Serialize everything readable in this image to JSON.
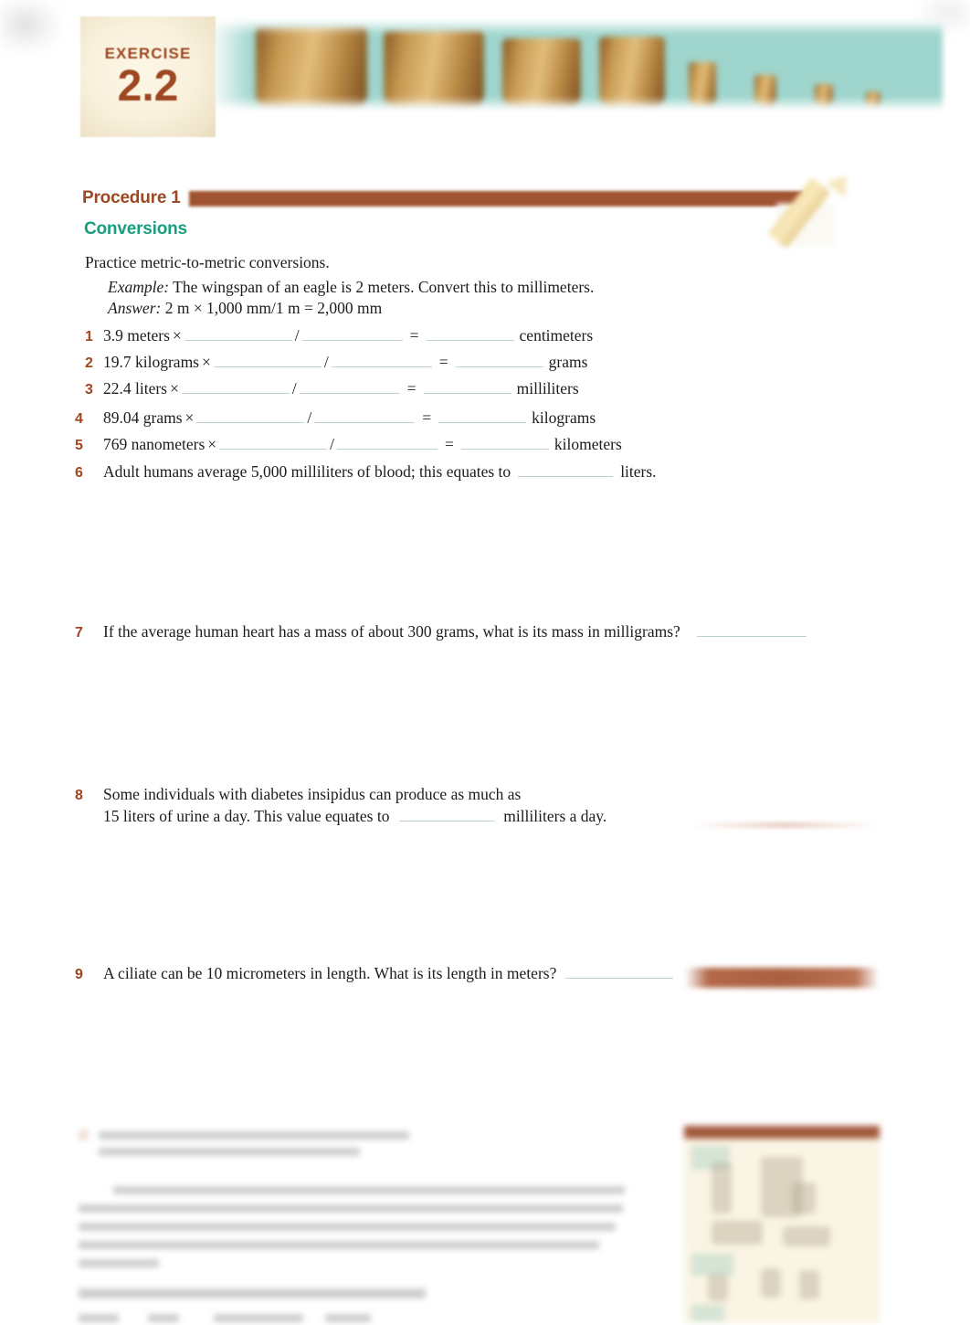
{
  "page": {
    "exercise_label": "EXERCISE",
    "exercise_number": "2.2"
  },
  "header": {
    "banner_icon": "beakers-graduated-cylinders-banner",
    "banner_bg_color": "#9ed5cd",
    "beaker_color": "#c79a51"
  },
  "procedure": {
    "label": "Procedure 1",
    "bar_color": "#a05330",
    "section_title": "Conversions",
    "section_title_color": "#189e7e",
    "label_color": "#9d4822",
    "pencil_icon": "pencil-writing-icon"
  },
  "body": {
    "intro": "Practice metric-to-metric conversions.",
    "example_label": "Example:",
    "example_text": "The wingspan of an eagle is 2 meters. Convert this to millimeters.",
    "answer_label": "Answer:",
    "answer_text": "2 m ×  1,000 mm/1 m = 2,000 mm"
  },
  "conversions": [
    {
      "num": "1",
      "quantity": "3.9 meters",
      "times": "×",
      "slash": "/",
      "equals": "=",
      "unit": "centimeters"
    },
    {
      "num": "2",
      "quantity": "19.7 kilograms",
      "times": "×",
      "slash": "/",
      "equals": "=",
      "unit": "grams"
    },
    {
      "num": "3",
      "quantity": "22.4 liters",
      "times": "×",
      "slash": "/",
      "equals": "=",
      "unit": "milliliters"
    },
    {
      "num": "4",
      "quantity": "89.04 grams",
      "times": "×",
      "slash": "/",
      "equals": "=",
      "unit": "kilograms"
    },
    {
      "num": "5",
      "quantity": "769 nanometers",
      "times": "×",
      "slash": "/",
      "equals": "=",
      "unit": "kilometers"
    }
  ],
  "questions": {
    "q6": {
      "num": "6",
      "pre": "Adult humans average 5,000 milliliters of blood; this equates to",
      "post": "liters."
    },
    "q7": {
      "num": "7",
      "pre": "If the average human heart has a mass of about 300 grams,   what is its mass in milligrams?"
    },
    "q8": {
      "num": "8",
      "line1": "Some individuals with diabetes insipidus can produce as much as",
      "line2_pre": "15 liters of urine a day. This value equates to",
      "line2_post": "milliliters a day."
    },
    "q9": {
      "num": "9",
      "pre": "A ciliate can be 10 micrometers in length. What is its length in meters?"
    }
  },
  "sidebar": {
    "faint_rule": "faded-horizontal-rule",
    "brown_bar": "faded-section-bar",
    "panel": "faded-reference-table-panel"
  },
  "footer": {
    "faded_block": "faded-unreadable-text-block"
  },
  "colors": {
    "accent_brown": "#9d4822",
    "accent_teal": "#189e7e",
    "blank_line": "#bcd2cd",
    "text": "#1c1c1c"
  }
}
